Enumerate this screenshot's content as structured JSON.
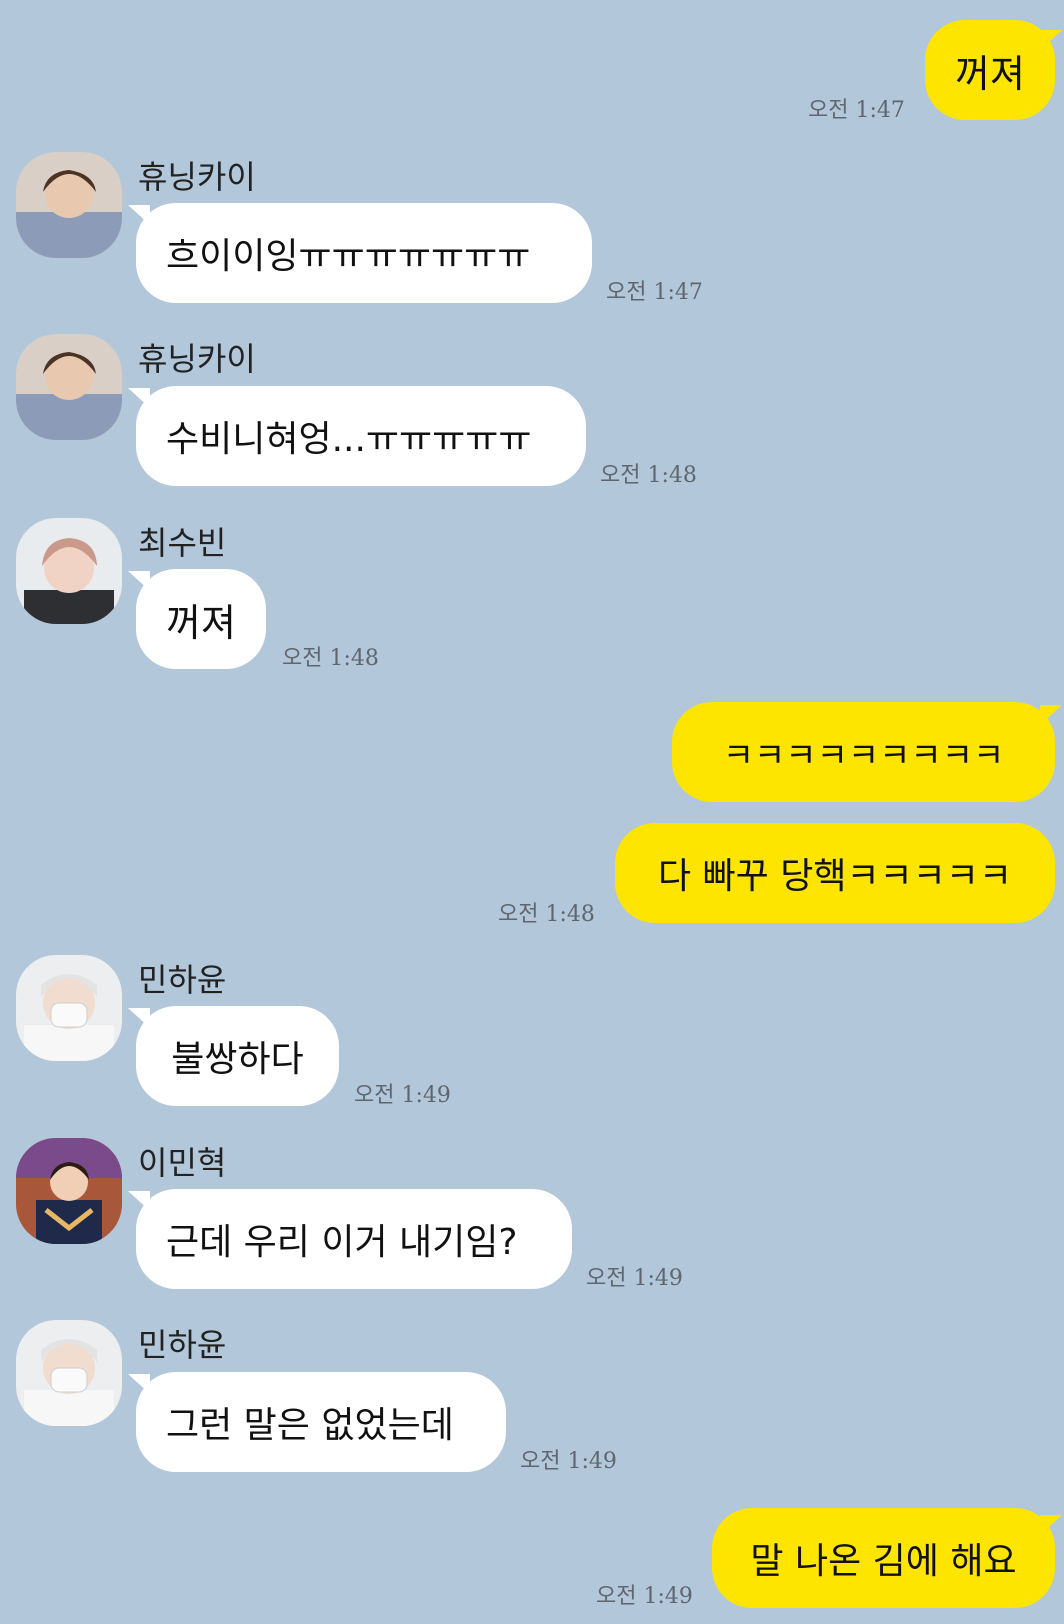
{
  "messages": [
    {
      "text": "꺼져",
      "time": "오전 1:47"
    },
    {
      "sender": "휴닝카이",
      "text": "흐이이잉ㅠㅠㅠㅠㅠㅠㅠ",
      "time": "오전 1:47"
    },
    {
      "sender": "휴닝카이",
      "text": "수비니혀엉...ㅠㅠㅠㅠㅠ",
      "time": "오전 1:48"
    },
    {
      "sender": "최수빈",
      "text": "꺼져",
      "time": "오전 1:48"
    },
    {
      "text": "ㅋㅋㅋㅋㅋㅋㅋㅋㅋ"
    },
    {
      "text": "다 빠꾸 당핵ㅋㅋㅋㅋㅋ",
      "time": "오전 1:48"
    },
    {
      "sender": "민하윤",
      "text": "불쌍하다",
      "time": "오전 1:49"
    },
    {
      "sender": "이민혁",
      "text": "근데 우리 이거 내기임?",
      "time": "오전 1:49"
    },
    {
      "sender": "민하윤",
      "text": "그런 말은 없었는데",
      "time": "오전 1:49"
    },
    {
      "text": "말 나온 김에 해요",
      "time": "오전 1:49"
    }
  ],
  "colors": {
    "background": "#b2c7d9",
    "outgoing_bubble": "#fee500",
    "incoming_bubble": "#ffffff"
  }
}
